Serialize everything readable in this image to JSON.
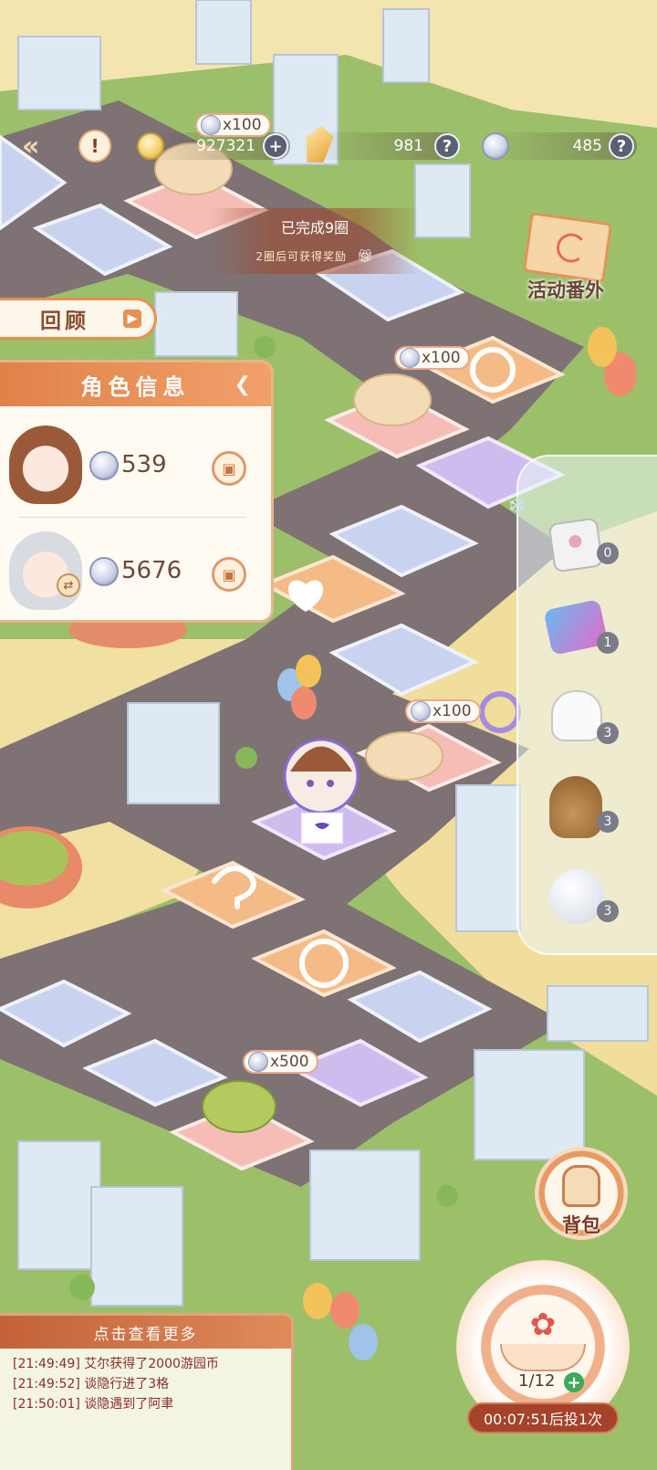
{
  "top_bar": {
    "back_icon": "double-chevron-left-icon",
    "alert_icon": "exclamation-icon",
    "gold": "927321",
    "crystal": "981",
    "silver": "485"
  },
  "round_banner": {
    "completed": "已完成9圈",
    "hint": "2圈后可获得奖励"
  },
  "event_button": "活动番外",
  "review_button": "回顾",
  "character_panel": {
    "title": "角色信息",
    "characters": [
      {
        "coins": "539",
        "swap": false
      },
      {
        "coins": "5676",
        "swap": true
      }
    ]
  },
  "tile_rewards": [
    "x100",
    "x100",
    "x100",
    "x500"
  ],
  "items": [
    {
      "name": "dice",
      "count": "0"
    },
    {
      "name": "swap-arrows",
      "count": "1"
    },
    {
      "name": "glove",
      "count": "3"
    },
    {
      "name": "sack",
      "count": "3"
    },
    {
      "name": "snowball",
      "count": "3"
    }
  ],
  "bag_button": "背包",
  "log": {
    "header": "点击查看更多",
    "lines": [
      "[21:49:49] 艾尔获得了2000游园币",
      "[21:49:52] 谈隐行进了3格",
      "[21:50:01] 谈隐遇到了阿聿"
    ]
  },
  "dice_roll": {
    "count": "1/12",
    "timer": "00:07:51后投1次"
  },
  "colors": {
    "grass": "#9cc06a",
    "road": "#7b6f72",
    "accent": "#e8904e",
    "tile_pink": "#f5b9b4",
    "tile_blue": "#c9d2ef",
    "tile_orange": "#f6c08a",
    "tile_purple": "#cbb8f0"
  }
}
